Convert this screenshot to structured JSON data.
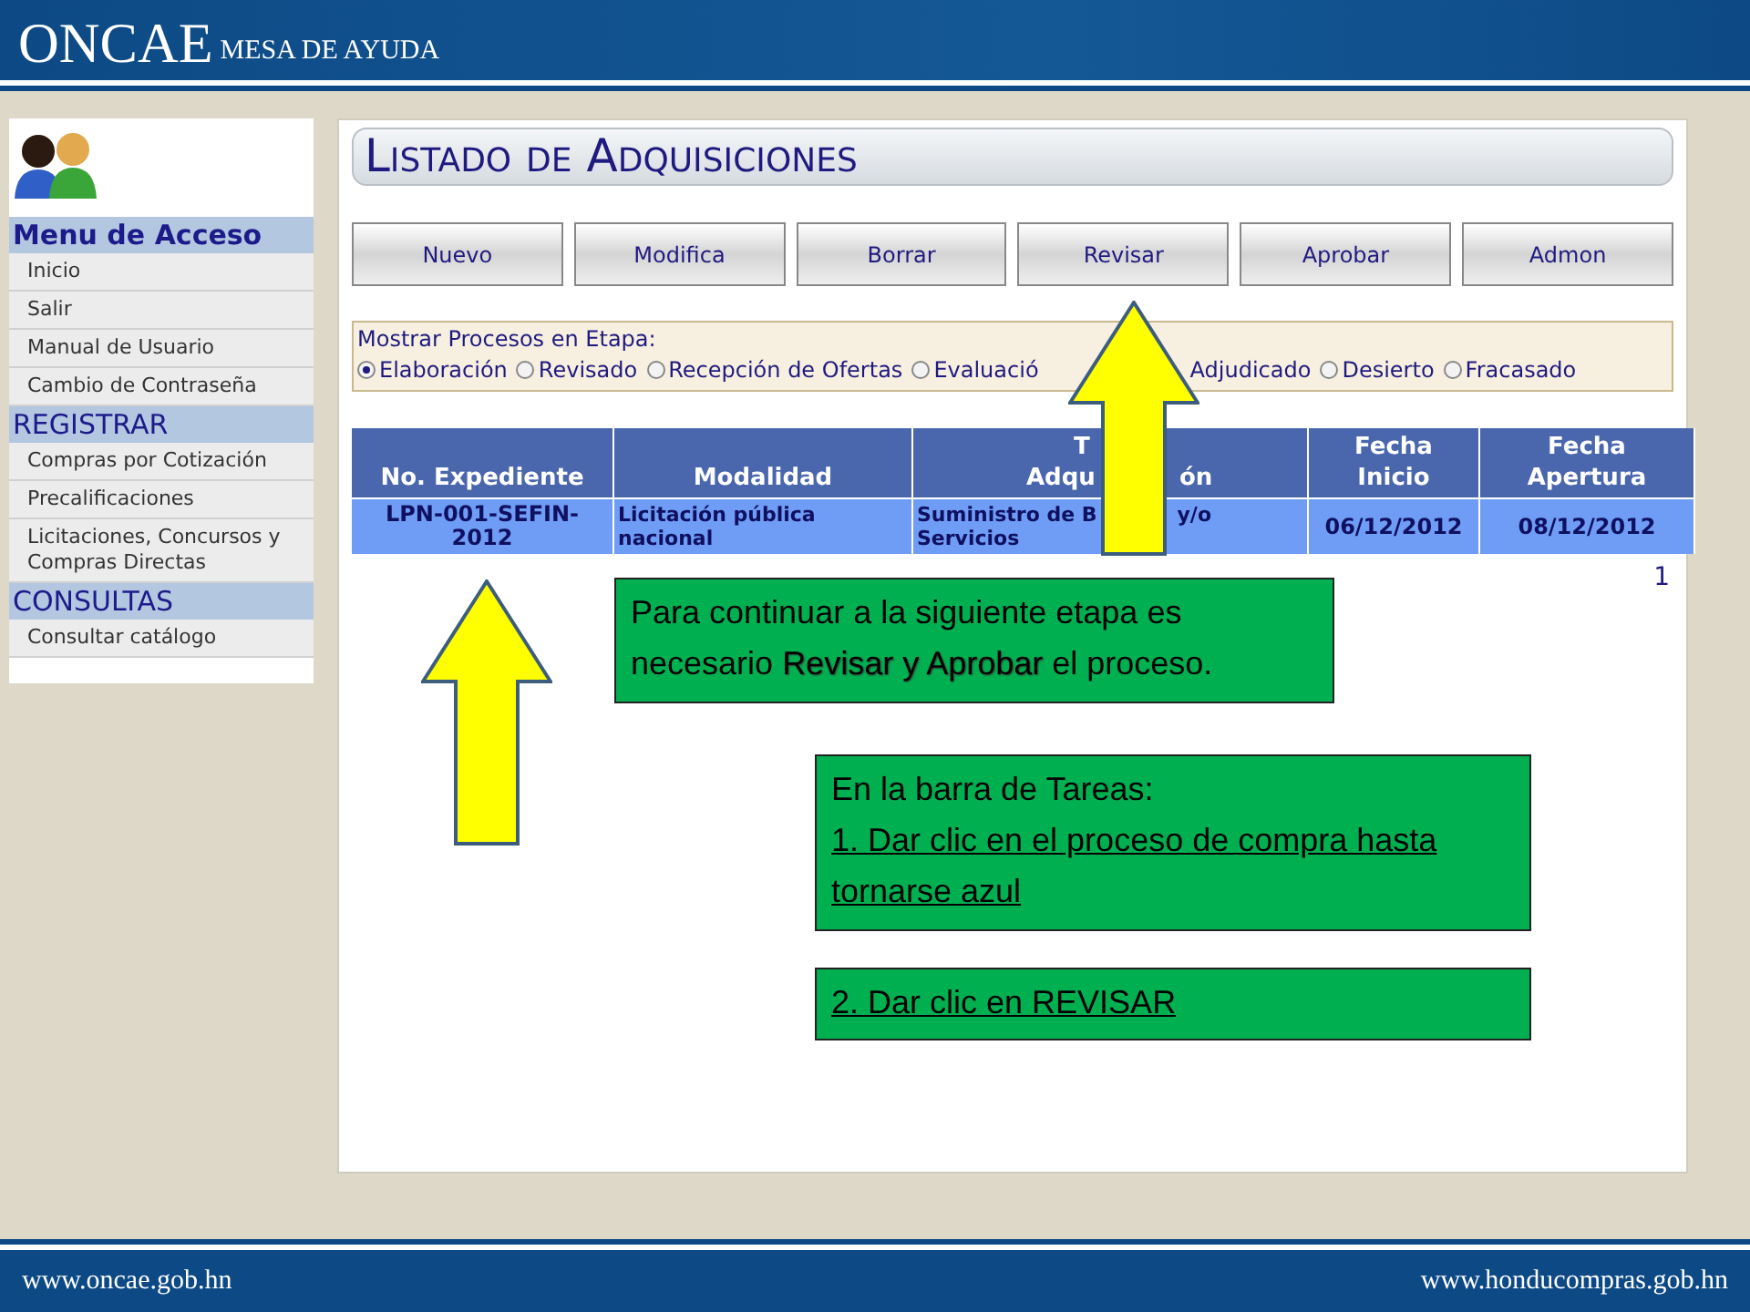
{
  "header": {
    "logo": "ONCAE",
    "subtitle": "MESA DE AYUDA"
  },
  "sidebar": {
    "sections": [
      {
        "title": "Menu de Acceso",
        "kind": "main",
        "items": [
          "Inicio",
          "Salir",
          "Manual de Usuario",
          "Cambio de Contraseña"
        ]
      },
      {
        "title": "REGISTRAR",
        "kind": "sub",
        "items": [
          "Compras por Cotización",
          "Precalificaciones",
          "Licitaciones, Concursos y Compras Directas"
        ]
      },
      {
        "title": "CONSULTAS",
        "kind": "sub",
        "items": [
          "Consultar catálogo"
        ]
      }
    ]
  },
  "page_title": "Listado de Adquisiciones",
  "toolbar": [
    "Nuevo",
    "Modifica",
    "Borrar",
    "Revisar",
    "Aprobar",
    "Admon"
  ],
  "filter": {
    "label": "Mostrar Procesos en Etapa:",
    "options": [
      {
        "label": "Elaboración",
        "selected": true
      },
      {
        "label": "Revisado",
        "selected": false
      },
      {
        "label": "Recepción de Ofertas",
        "selected": false
      },
      {
        "label": "Evaluació",
        "selected": false,
        "kind": "cut"
      },
      {
        "label": "Adjudicado",
        "kind": "covered"
      },
      {
        "label": "Desierto",
        "selected": false
      },
      {
        "label": "Fracasado",
        "selected": false
      }
    ]
  },
  "table": {
    "columns": [
      {
        "lines": [
          "No. Expediente"
        ]
      },
      {
        "lines": [
          "Modalidad"
        ]
      },
      {
        "lines": [
          "T",
          "Adqu",
          "ón"
        ],
        "kind": "covered"
      },
      {
        "lines": [
          "Fecha",
          "Inicio"
        ]
      },
      {
        "lines": [
          "Fecha",
          "Apertura"
        ]
      }
    ],
    "rows": [
      {
        "selected": true,
        "cells": [
          "LPN-001-SEFIN-2012",
          "Licitación pública nacional",
          [
            "Suministro de B",
            "y/o",
            "Servicios"
          ],
          "06/12/2012",
          "08/12/2012"
        ]
      }
    ]
  },
  "pager": "1",
  "notes": [
    {
      "text": "Para continuar a la siguiente etapa es necesario **Revisar y Aprobar** el proceso.",
      "kind": "plain"
    },
    {
      "text": "En la barra de Tareas:",
      "steps": [
        "1. Dar clic en el proceso de compra hasta tornarse azul"
      ],
      "kind": "steps"
    },
    {
      "steps": [
        "2. Dar clic en REVISAR"
      ],
      "kind": "steps"
    }
  ],
  "footer": {
    "left": "www.oncae.gob.hn",
    "right": "www.honducompras.gob.hn"
  }
}
